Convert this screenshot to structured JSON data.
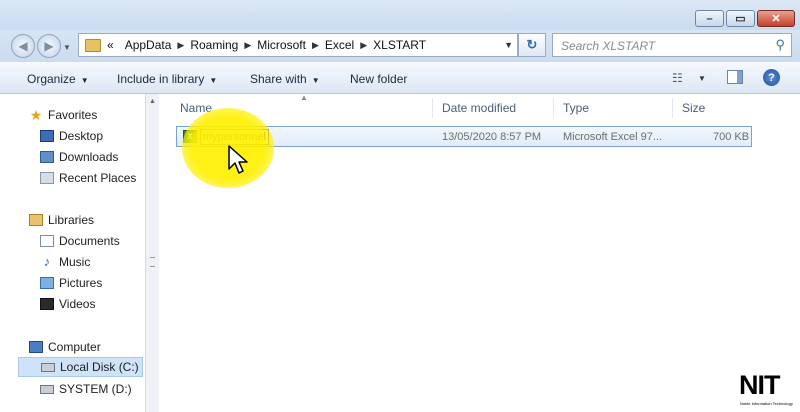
{
  "window": {
    "buttons": {
      "minimize": "–",
      "maximize": "▭",
      "close": "✕"
    }
  },
  "address": {
    "prefix": "«",
    "crumbs": [
      "AppData",
      "Roaming",
      "Microsoft",
      "Excel",
      "XLSTART"
    ],
    "search_placeholder": "Search XLSTART"
  },
  "toolbar": {
    "organize": "Organize",
    "include_in_library": "Include in library",
    "share_with": "Share with",
    "new_folder": "New folder"
  },
  "nav": {
    "favorites": "Favorites",
    "desktop": "Desktop",
    "downloads": "Downloads",
    "recent_places": "Recent Places",
    "libraries": "Libraries",
    "documents": "Documents",
    "music": "Music",
    "pictures": "Pictures",
    "videos": "Videos",
    "computer": "Computer",
    "local_disk": "Local Disk (C:)",
    "system_disk": "SYSTEM (D:)"
  },
  "columns": {
    "name": "Name",
    "date_modified": "Date modified",
    "type": "Type",
    "size": "Size"
  },
  "files": [
    {
      "name": "mypersonnel",
      "date_modified": "13/05/2020 8:57 PM",
      "type": "Microsoft Excel 97...",
      "size": "700 KB"
    }
  ],
  "logo": {
    "text": "NIT",
    "subtitle": "Noble Information Technology"
  },
  "colors": {
    "accent": "#3e6db5",
    "highlight": "#fff000"
  }
}
